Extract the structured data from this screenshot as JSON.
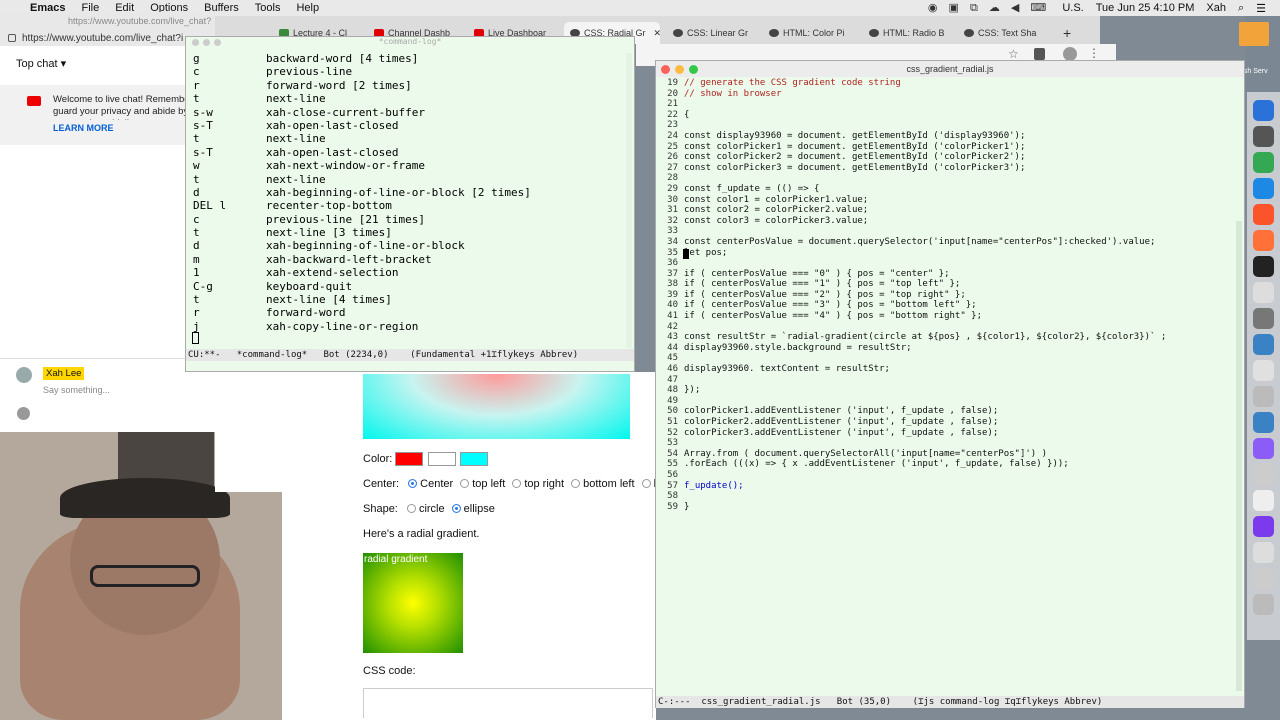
{
  "menubar": {
    "apple": "",
    "app": "Emacs",
    "items": [
      "File",
      "Edit",
      "Options",
      "Buffers",
      "Tools",
      "Help"
    ],
    "locale": "U.S.",
    "clock": "Tue Jun 25  4:10 PM",
    "user": "Xah"
  },
  "browser": {
    "tabs": [
      {
        "label": "Lecture 4 - Cl",
        "icon_color": "#3a8a3a"
      },
      {
        "label": "Channel Dashb",
        "icon_color": "#e00000"
      },
      {
        "label": "Live Dashboar",
        "icon_color": "#e00000"
      },
      {
        "label": "CSS: Radial Gr",
        "icon_color": "#444444"
      },
      {
        "label": "CSS: Linear Gr",
        "icon_color": "#444444"
      },
      {
        "label": "HTML: Color Pi",
        "icon_color": "#444444"
      },
      {
        "label": "HTML: Radio B",
        "icon_color": "#444444"
      },
      {
        "label": "CSS: Text Sha",
        "icon_color": "#444444"
      }
    ],
    "new_tab": "+"
  },
  "ytchat": {
    "url_small": "https://www.youtube.com/live_chat?",
    "url": "https://www.youtube.com/live_chat?i",
    "top_chat": "Top chat ▾",
    "welcome": "Welcome to live chat! Remember to guard your privacy and abide by our community guidelines.",
    "learn_more": "LEARN MORE",
    "user": "Xah Lee",
    "placeholder": "Say something..."
  },
  "webpage": {
    "color_label": "Color:",
    "swatch_colors": [
      "#ff0000",
      "#ffffff",
      "#00ffff"
    ],
    "center_label": "Center:",
    "center_options": [
      {
        "label": "Center",
        "checked": true
      },
      {
        "label": "top left",
        "checked": false
      },
      {
        "label": "top right",
        "checked": false
      },
      {
        "label": "bottom left",
        "checked": false
      },
      {
        "label": "botto",
        "checked": false
      }
    ],
    "shape_label": "Shape:",
    "shape_options": [
      {
        "label": "circle",
        "checked": false
      },
      {
        "label": "ellipse",
        "checked": true
      }
    ],
    "intro": "Here's a radial gradient.",
    "gradient_box_label": "radial gradient",
    "css_code_label": "CSS code:"
  },
  "cmdlog": {
    "title": "*command-log*",
    "rows": [
      {
        "key": "g",
        "cmd": "backward-word [4 times]"
      },
      {
        "key": "c",
        "cmd": "previous-line"
      },
      {
        "key": "r",
        "cmd": "forward-word [2 times]"
      },
      {
        "key": "t",
        "cmd": "next-line"
      },
      {
        "key": "s-w",
        "cmd": "xah-close-current-buffer"
      },
      {
        "key": "s-T",
        "cmd": "xah-open-last-closed"
      },
      {
        "key": "t",
        "cmd": "next-line"
      },
      {
        "key": "s-T",
        "cmd": "xah-open-last-closed"
      },
      {
        "key": "w",
        "cmd": "xah-next-window-or-frame"
      },
      {
        "key": "t",
        "cmd": "next-line"
      },
      {
        "key": "d",
        "cmd": "xah-beginning-of-line-or-block [2 times]"
      },
      {
        "key": "DEL l",
        "cmd": "recenter-top-bottom"
      },
      {
        "key": "c",
        "cmd": "previous-line [21 times]"
      },
      {
        "key": "t",
        "cmd": "next-line [3 times]"
      },
      {
        "key": "d",
        "cmd": "xah-beginning-of-line-or-block"
      },
      {
        "key": "m",
        "cmd": "xah-backward-left-bracket"
      },
      {
        "key": "1",
        "cmd": "xah-extend-selection"
      },
      {
        "key": "C-g",
        "cmd": "keyboard-quit"
      },
      {
        "key": "t",
        "cmd": "next-line [4 times]"
      },
      {
        "key": "r",
        "cmd": "forward-word"
      },
      {
        "key": "j",
        "cmd": "xah-copy-line-or-region"
      }
    ],
    "modeline": "CU:**-   *command-log*   Bot (2234,0)    (Fundamental +1⌶flykeys Abbrev)"
  },
  "codefile": {
    "title": "css_gradient_radial.js",
    "lines": [
      {
        "n": "19",
        "t": "// generate the CSS gradient code string"
      },
      {
        "n": "20",
        "t": "// show in browser"
      },
      {
        "n": "21",
        "t": ""
      },
      {
        "n": "22",
        "t": "{"
      },
      {
        "n": "23",
        "t": ""
      },
      {
        "n": "24",
        "t": "const display93960 = document. getElementById ('display93960');"
      },
      {
        "n": "25",
        "t": "const colorPicker1 = document. getElementById ('colorPicker1');"
      },
      {
        "n": "26",
        "t": "const colorPicker2 = document. getElementById ('colorPicker2');"
      },
      {
        "n": "27",
        "t": "const colorPicker3 = document. getElementById ('colorPicker3');"
      },
      {
        "n": "28",
        "t": ""
      },
      {
        "n": "29",
        "t": "const f_update = (() => {"
      },
      {
        "n": "30",
        "t": "const color1 = colorPicker1.value;"
      },
      {
        "n": "31",
        "t": "const color2 = colorPicker2.value;"
      },
      {
        "n": "32",
        "t": "const color3 = colorPicker3.value;"
      },
      {
        "n": "33",
        "t": ""
      },
      {
        "n": "34",
        "t": "const centerPosValue = document.querySelector('input[name=\"centerPos\"]:checked').value;"
      },
      {
        "n": "35",
        "t": "let pos;"
      },
      {
        "n": "36",
        "t": ""
      },
      {
        "n": "37",
        "t": "if ( centerPosValue === \"0\" ) { pos = \"center\" };"
      },
      {
        "n": "38",
        "t": "if ( centerPosValue === \"1\" ) { pos = \"top left\" };"
      },
      {
        "n": "39",
        "t": "if ( centerPosValue === \"2\" ) { pos = \"top right\" };"
      },
      {
        "n": "40",
        "t": "if ( centerPosValue === \"3\" ) { pos = \"bottom left\" };"
      },
      {
        "n": "41",
        "t": "if ( centerPosValue === \"4\" ) { pos = \"bottom right\" };"
      },
      {
        "n": "42",
        "t": ""
      },
      {
        "n": "43",
        "t": "const resultStr = `radial-gradient(circle at ${pos} , ${color1}, ${color2}, ${color3})` ;"
      },
      {
        "n": "44",
        "t": "display93960.style.background = resultStr;"
      },
      {
        "n": "45",
        "t": ""
      },
      {
        "n": "46",
        "t": "display93960. textContent = resultStr;"
      },
      {
        "n": "47",
        "t": ""
      },
      {
        "n": "48",
        "t": "});"
      },
      {
        "n": "49",
        "t": ""
      },
      {
        "n": "50",
        "t": "colorPicker1.addEventListener ('input', f_update , false);"
      },
      {
        "n": "51",
        "t": "colorPicker2.addEventListener ('input', f_update , false);"
      },
      {
        "n": "52",
        "t": "colorPicker3.addEventListener ('input', f_update , false);"
      },
      {
        "n": "53",
        "t": ""
      },
      {
        "n": "54",
        "t": "Array.from ( document.querySelectorAll('input[name=\"centerPos\"]') )"
      },
      {
        "n": "55",
        "t": ".forEach (((x) => { x .addEventListener ('input', f_update, false) }));"
      },
      {
        "n": "56",
        "t": ""
      },
      {
        "n": "57",
        "t": "f_update();"
      },
      {
        "n": "58",
        "t": ""
      },
      {
        "n": "59",
        "t": "}"
      }
    ],
    "modeline": "C-:---  css_gradient_radial.js   Bot (35,0)    (⌶js command-log ⌶q⌶flykeys Abbrev)"
  },
  "desktop": {
    "folder_label": "osh Serv"
  }
}
